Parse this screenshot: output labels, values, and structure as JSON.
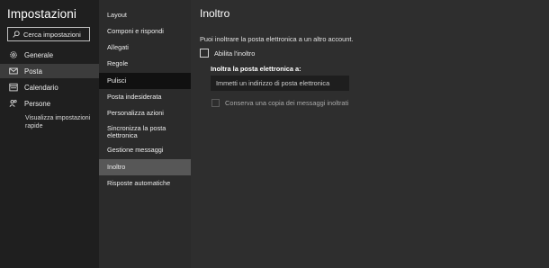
{
  "app": {
    "title": "Impostazioni"
  },
  "search": {
    "placeholder": "Cerca impostazioni",
    "icon": "search-icon"
  },
  "left_nav": {
    "items": [
      {
        "label": "Generale",
        "icon": "gear-icon"
      },
      {
        "label": "Posta",
        "icon": "mail-icon",
        "selected": true
      },
      {
        "label": "Calendario",
        "icon": "calendar-icon"
      },
      {
        "label": "Persone",
        "icon": "people-icon"
      }
    ],
    "quick_settings": "Visualizza impostazioni rapide"
  },
  "middle_nav": {
    "items": [
      {
        "label": "Layout"
      },
      {
        "label": "Componi e rispondi"
      },
      {
        "label": "Allegati"
      },
      {
        "label": "Regole"
      },
      {
        "label": "Pulisci"
      },
      {
        "label": "Posta indesiderata"
      },
      {
        "label": "Personalizza azioni"
      },
      {
        "label": "Sincronizza la posta elettronica"
      },
      {
        "label": "Gestione messaggi"
      },
      {
        "label": "Inoltro",
        "selected": true
      },
      {
        "label": "Risposte automatiche"
      }
    ]
  },
  "content": {
    "title": "Inoltro",
    "description": "Puoi inoltrare la posta elettronica a un altro account.",
    "enable_forwarding": {
      "label": "Abilita l'inoltro",
      "checked": false
    },
    "forward_to_label": "Inoltra la posta elettronica a:",
    "forward_to_placeholder": "Immetti un indirizzo di posta elettronica",
    "keep_copy": {
      "label": "Conserva una copia dei messaggi inoltrati",
      "checked": false,
      "disabled": true
    }
  },
  "colors": {
    "left_bg": "#1f1f1f",
    "middle_bg": "#2b2b2b",
    "right_bg": "#2e2e2e",
    "selected_left": "#3c3c3c",
    "selected_middle": "#575757"
  }
}
